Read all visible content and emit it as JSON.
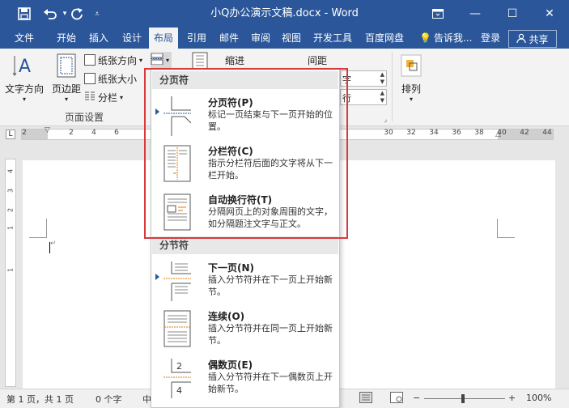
{
  "app": {
    "title": "小Q办公演示文稿.docx - Word",
    "quick_access": {
      "save_icon": "save-icon",
      "undo_icon": "undo-icon",
      "redo_icon": "redo-icon",
      "customize_icon": "chevron-down-icon"
    },
    "window": {
      "ribbon_options": "ribbon-display-icon",
      "minimize": "—",
      "maximize": "☐",
      "close": "✕"
    }
  },
  "tabs": [
    "文件",
    "开始",
    "插入",
    "设计",
    "布局",
    "引用",
    "邮件",
    "审阅",
    "视图",
    "开发工具",
    "百度网盘"
  ],
  "active_tab": "布局",
  "tell_me": "告诉我...",
  "login": "登录",
  "share": "共享",
  "ribbon": {
    "text_direction": "文字方向",
    "margins": "页边距",
    "orientation": "纸张方向",
    "size": "纸张大小",
    "columns": "分栏",
    "page_setup_group": "页面设置",
    "indent": "缩进",
    "spacing": "间距",
    "indent_right_unit": "字",
    "spacing_unit": "行",
    "arrange": "排列"
  },
  "ruler": {
    "h_ticks": [
      "2",
      "2",
      "4",
      "6",
      "30",
      "32",
      "34",
      "36",
      "38",
      "40",
      "42",
      "44"
    ],
    "v_ticks": [
      "4",
      "3",
      "2",
      "1",
      "1"
    ]
  },
  "status": {
    "page": "第 1 页，共 1 页",
    "words": "0 个字",
    "lang": "中",
    "zoom": "100%",
    "zoom_out": "−",
    "zoom_in": "+",
    "zoom_level": 1.0
  },
  "menu": {
    "page_breaks_header": "分页符",
    "page_breaks": [
      {
        "title": "分页符(P)",
        "desc": "标记一页结束与下一页开始的位置。",
        "icon": "page-break-icon"
      },
      {
        "title": "分栏符(C)",
        "desc": "指示分栏符后面的文字将从下一栏开始。",
        "icon": "column-break-icon"
      },
      {
        "title": "自动换行符(T)",
        "desc": "分隔网页上的对象周围的文字，如分隔题注文字与正文。",
        "icon": "text-wrapping-break-icon"
      }
    ],
    "section_breaks_header": "分节符",
    "section_breaks": [
      {
        "title": "下一页(N)",
        "desc": "插入分节符并在下一页上开始新节。",
        "icon": "next-page-section-icon"
      },
      {
        "title": "连续(O)",
        "desc": "插入分节符并在同一页上开始新节。",
        "icon": "continuous-section-icon"
      },
      {
        "title": "偶数页(E)",
        "desc": "插入分节符并在下一偶数页上开始新节。",
        "icon": "even-page-section-icon"
      }
    ]
  },
  "colors": {
    "accent": "#2b579a",
    "highlight_border": "#d9393b"
  }
}
